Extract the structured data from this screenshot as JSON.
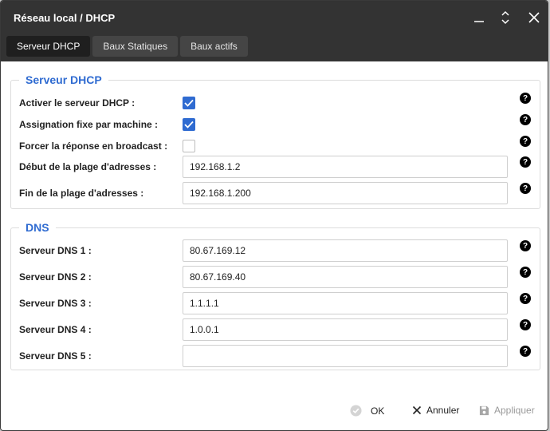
{
  "window": {
    "title": "Réseau local / DHCP"
  },
  "tabs": [
    {
      "label": "Serveur DHCP",
      "active": true
    },
    {
      "label": "Baux Statiques",
      "active": false
    },
    {
      "label": "Baux actifs",
      "active": false
    }
  ],
  "dhcp": {
    "legend": "Serveur DHCP",
    "enable_label": "Activer le serveur DHCP :",
    "enable_checked": true,
    "fixed_label": "Assignation fixe par machine :",
    "fixed_checked": true,
    "broadcast_label": "Forcer la réponse en broadcast :",
    "broadcast_checked": false,
    "range_start_label": "Début de la plage d'adresses :",
    "range_start_value": "192.168.1.2",
    "range_end_label": "Fin de la plage d'adresses :",
    "range_end_value": "192.168.1.200"
  },
  "dns": {
    "legend": "DNS",
    "servers": [
      {
        "label": "Serveur DNS 1 :",
        "value": "80.67.169.12"
      },
      {
        "label": "Serveur DNS 2 :",
        "value": "80.67.169.40"
      },
      {
        "label": "Serveur DNS 3 :",
        "value": "1.1.1.1"
      },
      {
        "label": "Serveur DNS 4 :",
        "value": "1.0.0.1"
      },
      {
        "label": "Serveur DNS 5 :",
        "value": ""
      }
    ]
  },
  "help_glyph": "?",
  "footer": {
    "ok_label": "OK",
    "cancel_label": "Annuler",
    "apply_label": "Appliquer"
  },
  "colors": {
    "accent": "#2f6bd1",
    "titlebar": "#333333"
  }
}
